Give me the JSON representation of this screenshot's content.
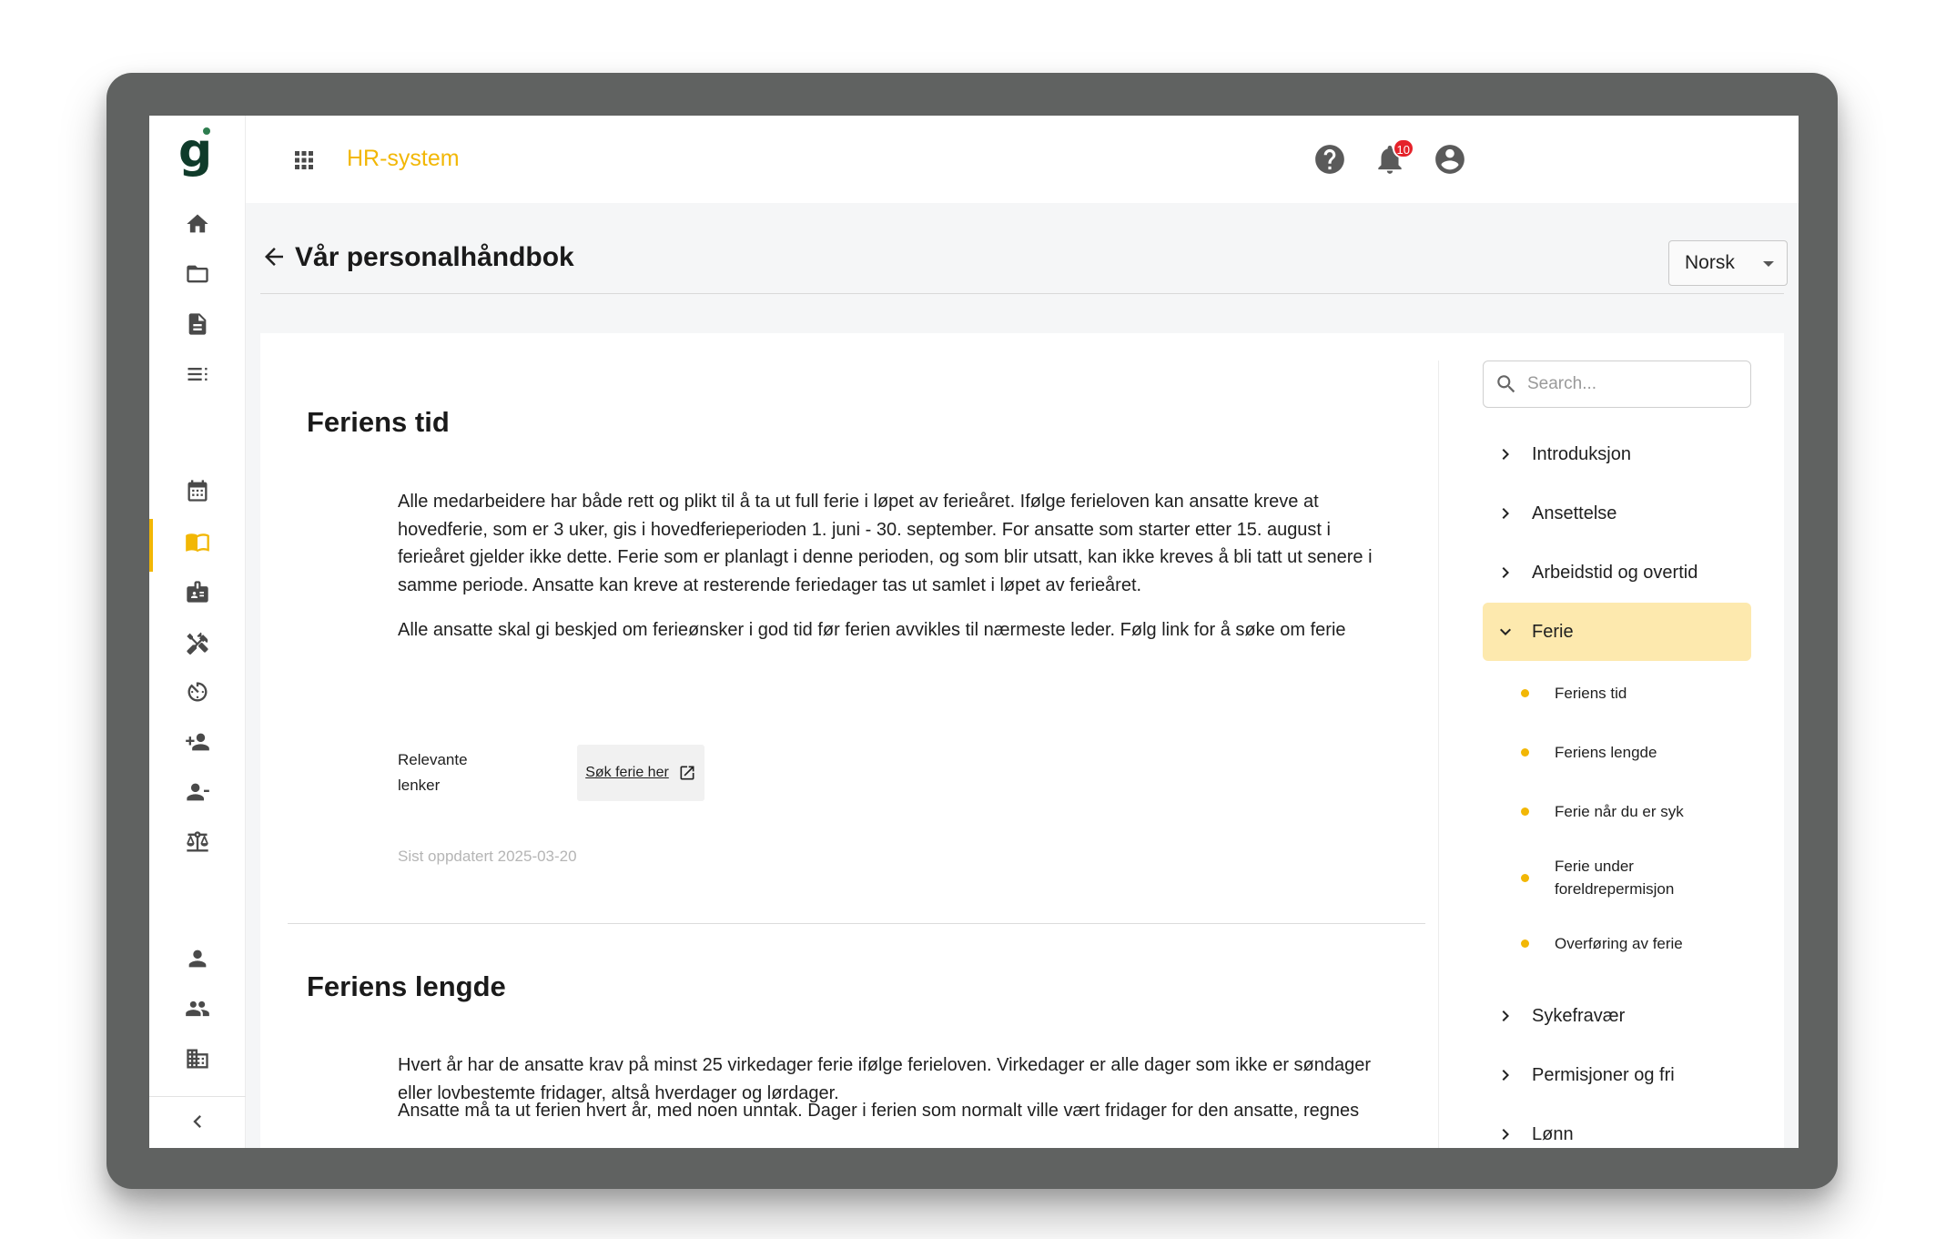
{
  "app": {
    "logo_letter": "g",
    "title": "HR-system",
    "notification_count": "10",
    "accent_color": "#f2b705",
    "badge_color": "#e5222a"
  },
  "rail": {
    "icons": [
      "home-icon",
      "folder-icon",
      "document-icon",
      "list-icon",
      "calendar-icon",
      "handbook-icon",
      "badge-icon",
      "tools-icon",
      "timer-icon",
      "add-person-icon",
      "remove-person-icon",
      "scale-icon",
      "person-icon",
      "group-icon",
      "building-icon",
      "collapse-icon"
    ],
    "active": "handbook-icon"
  },
  "header": {
    "title": "Vår personalhåndbok",
    "language": "Norsk"
  },
  "sections": [
    {
      "title": "Feriens tid",
      "paragraphs": [
        "Alle medarbeidere har både rett og plikt til å ta ut full ferie i løpet av ferieåret. Ifølge ferieloven kan ansatte kreve at hovedferie, som er 3 uker, gis i hovedferieperioden 1. juni - 30. september. For ansatte som starter etter 15. august i ferieåret gjelder ikke dette. Ferie som er planlagt i denne perioden, og som blir utsatt, kan ikke kreves å bli tatt ut senere i samme periode. Ansatte kan kreve at resterende feriedager tas ut samlet i løpet av ferieåret.",
        "Alle ansatte skal gi beskjed om ferieønsker i god tid før ferien avvikles til nærmeste leder.  Følg link for å søke om ferie"
      ],
      "links_label": "Relevante lenker",
      "link_text": "Søk ferie her",
      "updated": "Sist oppdatert 2025-03-20"
    },
    {
      "title": "Feriens lengde",
      "paragraphs": [
        "Hvert år har de ansatte krav på minst 25 virkedager ferie ifølge ferieloven. Virkedager er alle dager som ikke er søndager eller lovbestemte fridager, altså hverdager og lørdager.",
        "Ansatte må ta ut ferien hvert år, med noen unntak. Dager i ferien som normalt ville vært fridager for den ansatte, regnes"
      ]
    }
  ],
  "toc": {
    "search_placeholder": "Search...",
    "items": [
      "Introduksjon",
      "Ansettelse",
      "Arbeidstid og overtid",
      "Ferie",
      "Sykefravær",
      "Permisjoner og fri",
      "Lønn"
    ],
    "active_item": "Ferie",
    "sub_items": [
      "Feriens tid",
      "Feriens lengde",
      "Ferie når du er syk",
      "Ferie under foreldrepermisjon",
      "Overføring av ferie"
    ]
  }
}
